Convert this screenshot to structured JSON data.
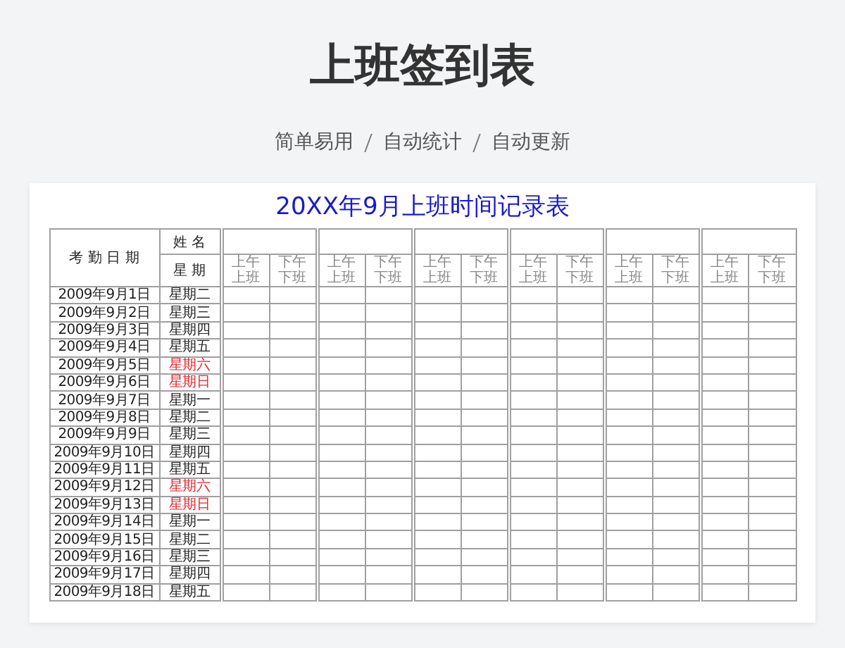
{
  "title": "上班签到表",
  "subtitle": [
    "简单易用",
    "自动统计",
    "自动更新"
  ],
  "sheet": {
    "title": "20XX年9月上班时间记录表",
    "header": {
      "date_label": "考 勤 日 期",
      "name_label": "姓 名",
      "weekday_label": "星 期"
    },
    "groups": [
      {
        "subcolumns": [
          {
            "lines": [
              "上午",
              "上班"
            ]
          },
          {
            "lines": [
              "下午",
              "下班"
            ]
          }
        ]
      },
      {
        "subcolumns": [
          {
            "lines": [
              "上午",
              "上班"
            ]
          },
          {
            "lines": [
              "下午",
              "下班"
            ]
          }
        ]
      },
      {
        "subcolumns": [
          {
            "lines": [
              "上午",
              "上班"
            ]
          },
          {
            "lines": [
              "下午",
              "下班"
            ]
          }
        ]
      },
      {
        "subcolumns": [
          {
            "lines": [
              "上午",
              "上班"
            ]
          },
          {
            "lines": [
              "下午",
              "下班"
            ]
          }
        ]
      },
      {
        "subcolumns": [
          {
            "lines": [
              "上午",
              "上班"
            ]
          },
          {
            "lines": [
              "下午",
              "下班"
            ]
          }
        ]
      },
      {
        "subcolumns": [
          {
            "lines": [
              "上午",
              "上班"
            ]
          },
          {
            "lines": [
              "下午",
              "下班"
            ]
          }
        ]
      }
    ],
    "rows": [
      {
        "date": "2009年9月1日",
        "weekday": "星期二",
        "weekend": false
      },
      {
        "date": "2009年9月2日",
        "weekday": "星期三",
        "weekend": false
      },
      {
        "date": "2009年9月3日",
        "weekday": "星期四",
        "weekend": false
      },
      {
        "date": "2009年9月4日",
        "weekday": "星期五",
        "weekend": false
      },
      {
        "date": "2009年9月5日",
        "weekday": "星期六",
        "weekend": true
      },
      {
        "date": "2009年9月6日",
        "weekday": "星期日",
        "weekend": true
      },
      {
        "date": "2009年9月7日",
        "weekday": "星期一",
        "weekend": false
      },
      {
        "date": "2009年9月8日",
        "weekday": "星期二",
        "weekend": false
      },
      {
        "date": "2009年9月9日",
        "weekday": "星期三",
        "weekend": false
      },
      {
        "date": "2009年9月10日",
        "weekday": "星期四",
        "weekend": false
      },
      {
        "date": "2009年9月11日",
        "weekday": "星期五",
        "weekend": false
      },
      {
        "date": "2009年9月12日",
        "weekday": "星期六",
        "weekend": true
      },
      {
        "date": "2009年9月13日",
        "weekday": "星期日",
        "weekend": true
      },
      {
        "date": "2009年9月14日",
        "weekday": "星期一",
        "weekend": false
      },
      {
        "date": "2009年9月15日",
        "weekday": "星期二",
        "weekend": false
      },
      {
        "date": "2009年9月16日",
        "weekday": "星期三",
        "weekend": false
      },
      {
        "date": "2009年9月17日",
        "weekday": "星期四",
        "weekend": false
      },
      {
        "date": "2009年9月18日",
        "weekday": "星期五",
        "weekend": false
      }
    ]
  }
}
